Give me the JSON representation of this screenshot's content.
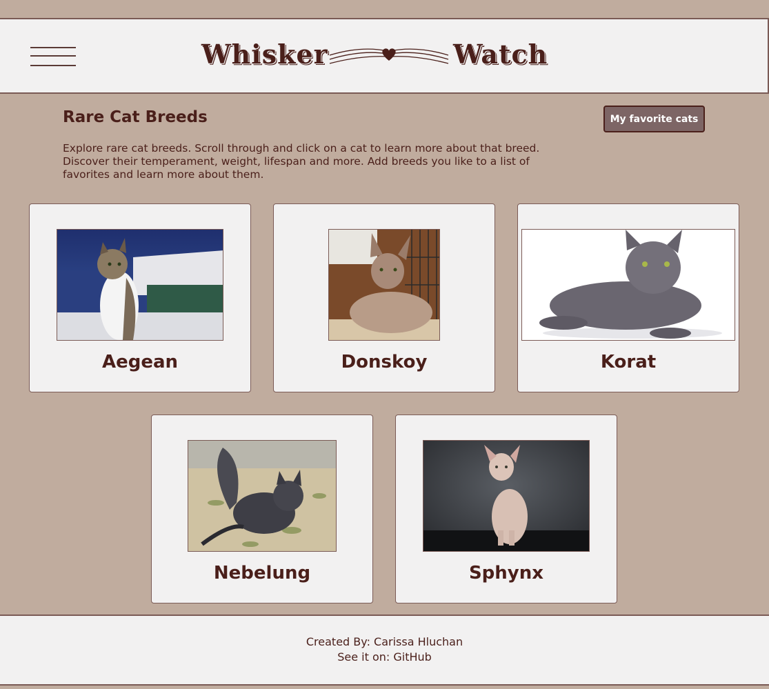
{
  "header": {
    "logo_left": "Whisker",
    "logo_right": "Watch",
    "menu_icon": "hamburger-menu-icon",
    "logo_icon": "whisker-heart-icon"
  },
  "main": {
    "title": "Rare Cat Breeds",
    "favorites_button": "My favorite cats",
    "intro": "Explore rare cat breeds. Scroll through and click on a cat to learn more about that breed. Discover their temperament, weight, lifespan and more. Add breeds you like to a list of favorites and learn more about them."
  },
  "breeds": [
    {
      "name": "Aegean"
    },
    {
      "name": "Donskoy"
    },
    {
      "name": "Korat"
    },
    {
      "name": "Nebelung"
    },
    {
      "name": "Sphynx"
    }
  ],
  "footer": {
    "created_prefix": "Created By: ",
    "author": "Carissa Hluchan",
    "see_prefix": "See it on: ",
    "link": "GitHub"
  },
  "colors": {
    "background": "#c0ac9e",
    "panel": "#f2f1f1",
    "text": "#4a1f1a",
    "button": "#7d6565",
    "border": "#7a5a55"
  }
}
